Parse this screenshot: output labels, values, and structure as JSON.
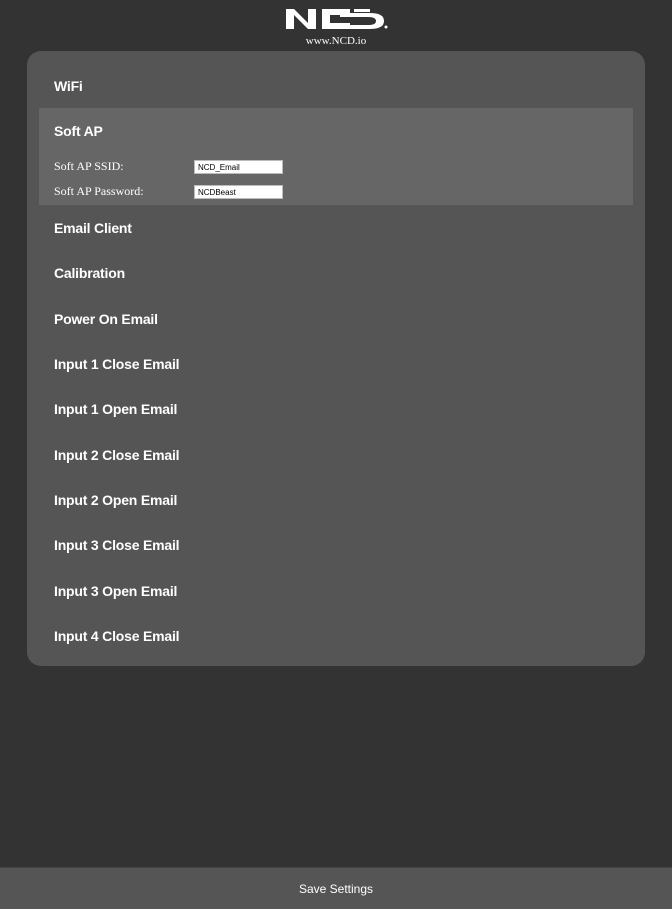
{
  "header": {
    "logo_text": "NCD",
    "site_url": "www.NCD.io"
  },
  "sections": {
    "wifi": "WiFi",
    "soft_ap": {
      "title": "Soft AP",
      "ssid_label": "Soft AP SSID:",
      "ssid_value": "NCD_Email",
      "password_label": "Soft AP Password:",
      "password_value": "NCDBeast"
    },
    "email_client": "Email Client",
    "calibration": "Calibration",
    "power_on_email": "Power On Email",
    "input1_close": "Input 1 Close Email",
    "input1_open": "Input 1 Open Email",
    "input2_close": "Input 2 Close Email",
    "input2_open": "Input 2 Open Email",
    "input3_close": "Input 3 Close Email",
    "input3_open": "Input 3 Open Email",
    "input4_close": "Input 4 Close Email"
  },
  "footer": {
    "save_label": "Save Settings"
  },
  "colors": {
    "page_background": "#333333",
    "panel_background": "#555555",
    "active_section_background": "#666666",
    "text": "#ffffff"
  },
  "icons": {
    "logo": "ncd-logo"
  }
}
